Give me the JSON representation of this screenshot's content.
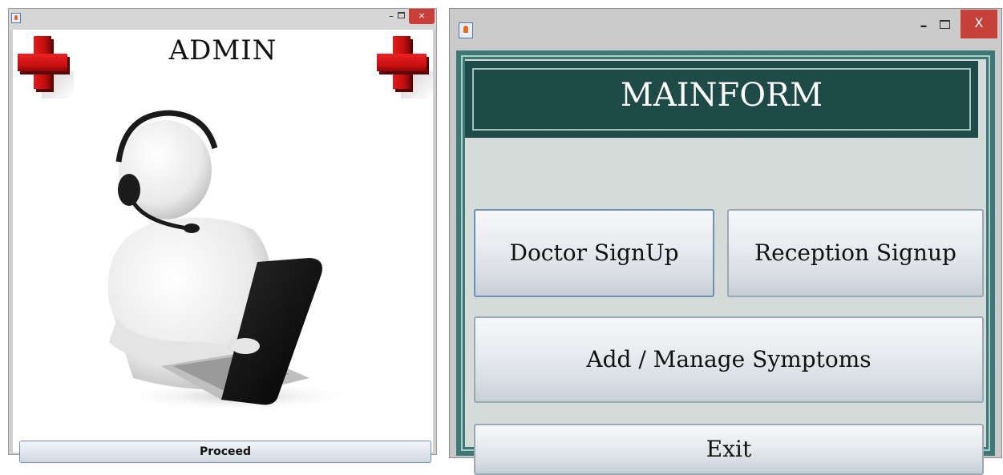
{
  "admin_window": {
    "title": "ADMIN",
    "icons": [
      "app-icon",
      "minimize-icon",
      "maximize-icon",
      "close-icon",
      "red-cross-icon",
      "support-person-laptop-illustration"
    ],
    "proceed_label": "Proceed",
    "close_glyph": "×",
    "minimize_glyph": "–"
  },
  "main_window": {
    "header": "MAINFORM",
    "buttons": {
      "doctor_signup": "Doctor SignUp",
      "reception_signup": "Reception Signup",
      "manage_symptoms": "Add / Manage Symptoms",
      "exit": "Exit"
    },
    "close_glyph": "X",
    "minimize_glyph": "–",
    "colors": {
      "frame": "#3e7876",
      "header_bg": "#1e4a47",
      "close_red": "#c7413b",
      "cross_red": "#d61515"
    }
  }
}
